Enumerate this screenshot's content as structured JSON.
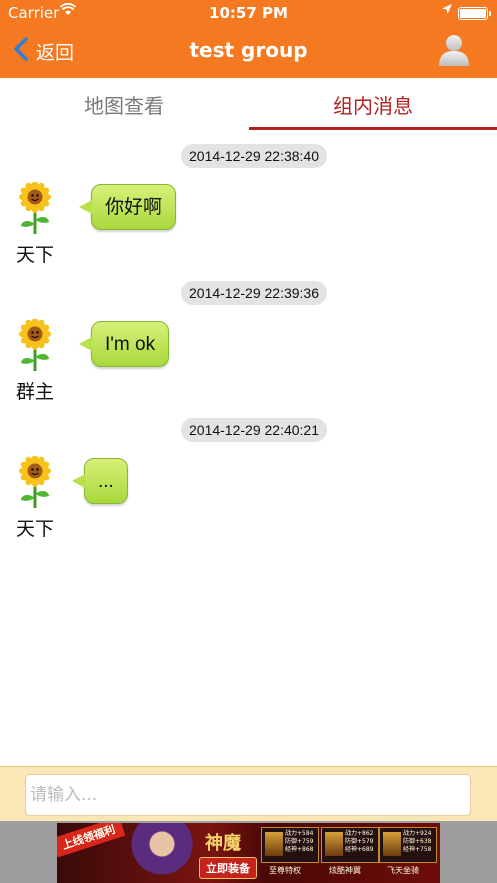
{
  "status_bar": {
    "carrier": "Carrier",
    "time": "10:57 PM"
  },
  "nav": {
    "back_label": "返回",
    "title": "test group"
  },
  "tabs": [
    {
      "label": "地图查看",
      "selected": false
    },
    {
      "label": "组内消息",
      "selected": true
    }
  ],
  "messages": [
    {
      "timestamp": "2014-12-29 22:38:40",
      "sender": "天下",
      "text": "你好啊"
    },
    {
      "timestamp": "2014-12-29 22:39:36",
      "sender": "群主",
      "text": "I'm ok"
    },
    {
      "timestamp": "2014-12-29 22:40:21",
      "sender": "天下",
      "text": "..."
    }
  ],
  "input": {
    "placeholder": "请输入...",
    "value": ""
  },
  "ad": {
    "ribbon": "上线领福利",
    "logo": "神魔",
    "cta": "立即装备",
    "panels": [
      {
        "stats": "战力+584\n防御+759\n经神+868",
        "label": "至尊特权"
      },
      {
        "stats": "战力+862\n防御+579\n经神+689",
        "label": "炫酷神翼"
      },
      {
        "stats": "战力+924\n防御+638\n经神+758",
        "label": "飞天坐骑"
      }
    ]
  },
  "colors": {
    "nav_bg": "#f47920",
    "tab_active": "#b22222",
    "bubble": "#b8e04b",
    "input_bar": "#fbe6b6"
  },
  "icons": [
    "back-chevron-icon",
    "wifi-icon",
    "location-arrow-icon",
    "battery-icon",
    "profile-icon",
    "sunflower-avatar-icon"
  ]
}
